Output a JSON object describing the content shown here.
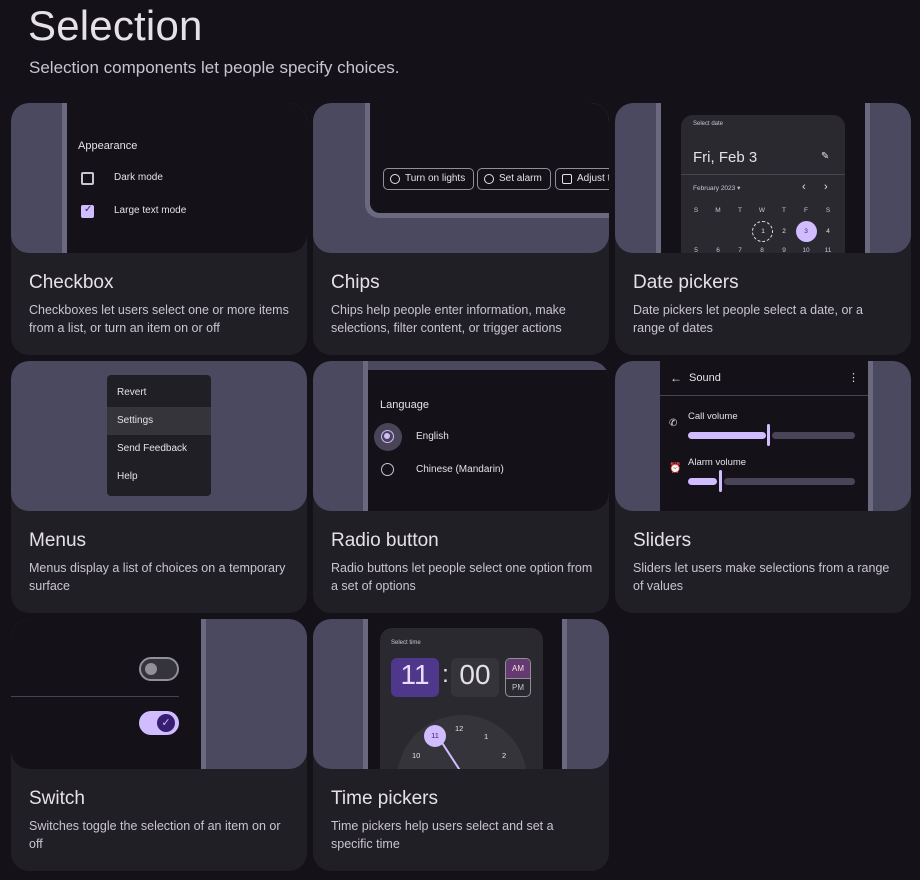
{
  "header": {
    "title": "Selection",
    "subtitle": "Selection components let people specify choices."
  },
  "cards": [
    {
      "title": "Checkbox",
      "description": "Checkboxes let users select one or more items from a list, or turn an item on or off"
    },
    {
      "title": "Chips",
      "description": "Chips help people enter information, make selections, filter content, or trigger actions"
    },
    {
      "title": "Date pickers",
      "description": "Date pickers let people select a date, or a range of dates"
    },
    {
      "title": "Menus",
      "description": "Menus display a list of choices on a temporary surface"
    },
    {
      "title": "Radio button",
      "description": "Radio buttons let people select one option from a set of options"
    },
    {
      "title": "Sliders",
      "description": "Sliders let users make selections from a range of values"
    },
    {
      "title": "Switch",
      "description": "Switches toggle the selection of an item on or off"
    },
    {
      "title": "Time pickers",
      "description": "Time pickers help users select and set a specific time"
    }
  ],
  "checkbox_demo": {
    "heading": "Appearance",
    "options": [
      {
        "label": "Dark mode",
        "checked": false
      },
      {
        "label": "Large text mode",
        "checked": true
      }
    ]
  },
  "chips_demo": {
    "chips": [
      "Turn on lights",
      "Set alarm",
      "Adjust t"
    ]
  },
  "datepicker_demo": {
    "label": "Select date",
    "date": "Fri, Feb 3",
    "month": "February 2023",
    "weekdays": [
      "S",
      "M",
      "T",
      "W",
      "T",
      "F",
      "S"
    ],
    "row1": [
      "",
      "",
      "",
      "1",
      "2",
      "3",
      "4"
    ],
    "row2": [
      "5",
      "6",
      "7",
      "8",
      "9",
      "10",
      "11"
    ],
    "selected_day": "3"
  },
  "menus_demo": {
    "items": [
      "Revert",
      "Settings",
      "Send Feedback",
      "Help"
    ]
  },
  "radio_demo": {
    "heading": "Language",
    "options": [
      {
        "label": "English",
        "selected": true
      },
      {
        "label": "Chinese (Mandarin)",
        "selected": false
      }
    ]
  },
  "sliders_demo": {
    "title": "Sound",
    "sliders": [
      {
        "label": "Call volume",
        "value": 0.47
      },
      {
        "label": "Alarm volume",
        "value": 0.19
      }
    ]
  },
  "switch_demo": {
    "switches": [
      {
        "on": false
      },
      {
        "on": true
      }
    ]
  },
  "timepicker_demo": {
    "label": "Select time",
    "hour": "11",
    "separator": ":",
    "minute": "00",
    "am": "AM",
    "pm": "PM",
    "dial": [
      "11",
      "12",
      "1",
      "10",
      "2"
    ]
  },
  "colors": {
    "background": "#141218",
    "card": "#211f26",
    "thumb": "#4b4960",
    "accent": "#d0bcff",
    "hour_box": "#4f378b",
    "am_box": "#633b70"
  }
}
